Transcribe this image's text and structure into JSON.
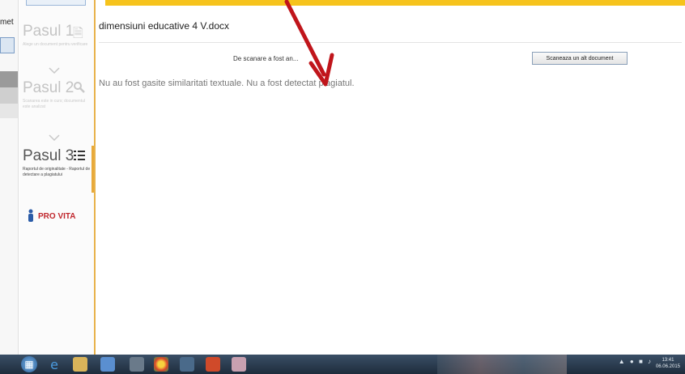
{
  "left_window": {
    "partial_label": "met"
  },
  "steps": [
    {
      "title": "Pasul 1",
      "description": "Alege un document pentru verificare",
      "icon": "document-icon",
      "active": false
    },
    {
      "title": "Pasul 2",
      "description": "Scanarea este in curs; documentul este analizat",
      "icon": "search-icon",
      "active": false
    },
    {
      "title": "Pasul 3",
      "description": "Raportul de originalitate - Raportul de detectare a plagiatului",
      "icon": "list-icon",
      "active": true
    }
  ],
  "logo": {
    "text": "PRO VITA"
  },
  "main": {
    "document_title": "dimensiuni educative 4 V.docx",
    "status_text": "De scanare a fost an...",
    "rescan_button": "Scaneaza un alt document",
    "result_text": "Nu au fost gasite similaritati textuale. Nu a fost detectat plagiatul."
  },
  "annotation": {
    "arrow_color": "#c0151b"
  },
  "colors": {
    "accent": "#f6c31c",
    "active_step": "#e8a93a"
  },
  "taskbar": {
    "apps": [
      "windows-start-icon",
      "ie-icon",
      "explorer-icon",
      "notepad-icon",
      "media-icon",
      "chrome-icon",
      "network-icon",
      "powerpoint-icon",
      "search-app-icon"
    ],
    "clock_time": "13:41",
    "clock_date": "06.06.2015"
  }
}
